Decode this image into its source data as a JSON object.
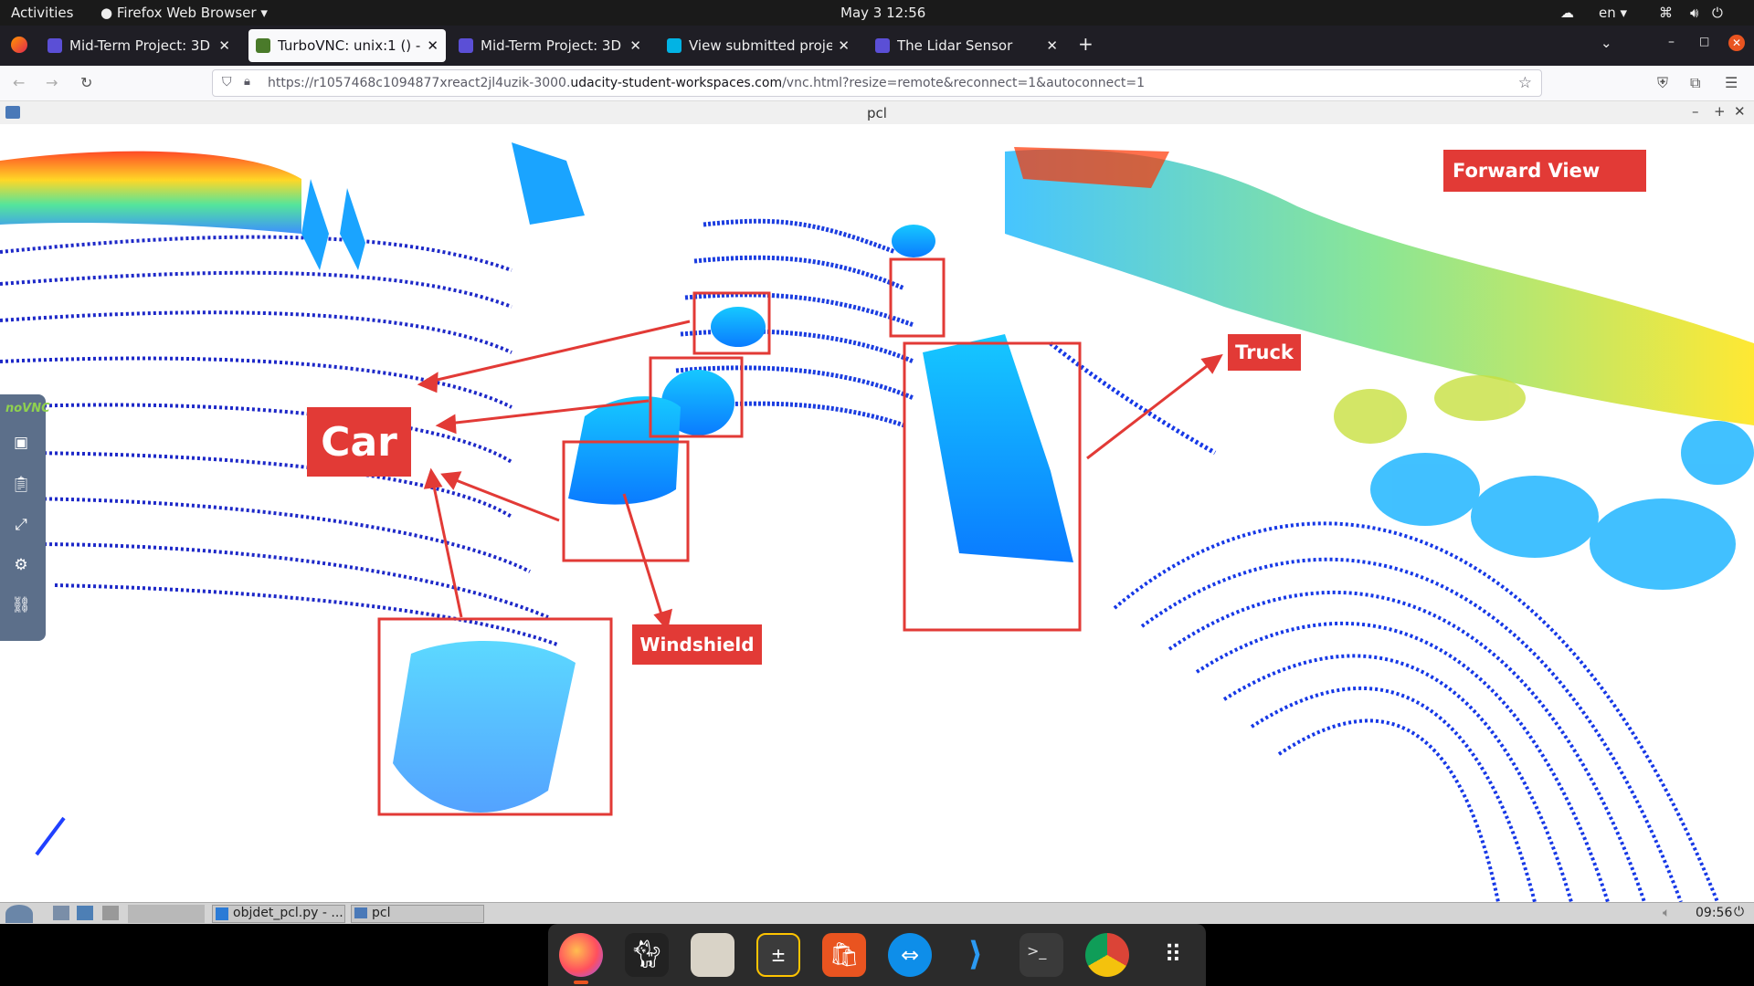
{
  "topbar": {
    "activities": "Activities",
    "app_menu": "Firefox Web Browser",
    "datetime": "May 3  12:56",
    "lang": "en"
  },
  "tabs": [
    {
      "title": "Mid-Term Project: 3D Obj",
      "color": "#5b4fd6"
    },
    {
      "title": "TurboVNC: unix:1 () - noV",
      "color": "#4a7a2a",
      "active": true
    },
    {
      "title": "Mid-Term Project: 3D Obj",
      "color": "#5b4fd6"
    },
    {
      "title": "View submitted project",
      "color": "#02b3e4"
    },
    {
      "title": "The Lidar Sensor",
      "color": "#5b4fd6"
    }
  ],
  "url": {
    "prefix": "https://r1057468c1094877xreact2jl4uzik-3000.",
    "domain": "udacity-student-workspaces.com",
    "suffix": "/vnc.html?resize=remote&reconnect=1&autoconnect=1"
  },
  "window": {
    "title": "pcl"
  },
  "labels": {
    "forward_view": "Forward View",
    "car": "Car",
    "truck": "Truck",
    "windshield": "Windshield"
  },
  "vnc_logo": "noVNC",
  "vnc_taskbar": {
    "task1": "objdet_pcl.py - ...",
    "task2": "pcl",
    "clock": "09:56"
  },
  "colors": {
    "annotation": "#e23a36",
    "accent": "#e55b1f"
  }
}
